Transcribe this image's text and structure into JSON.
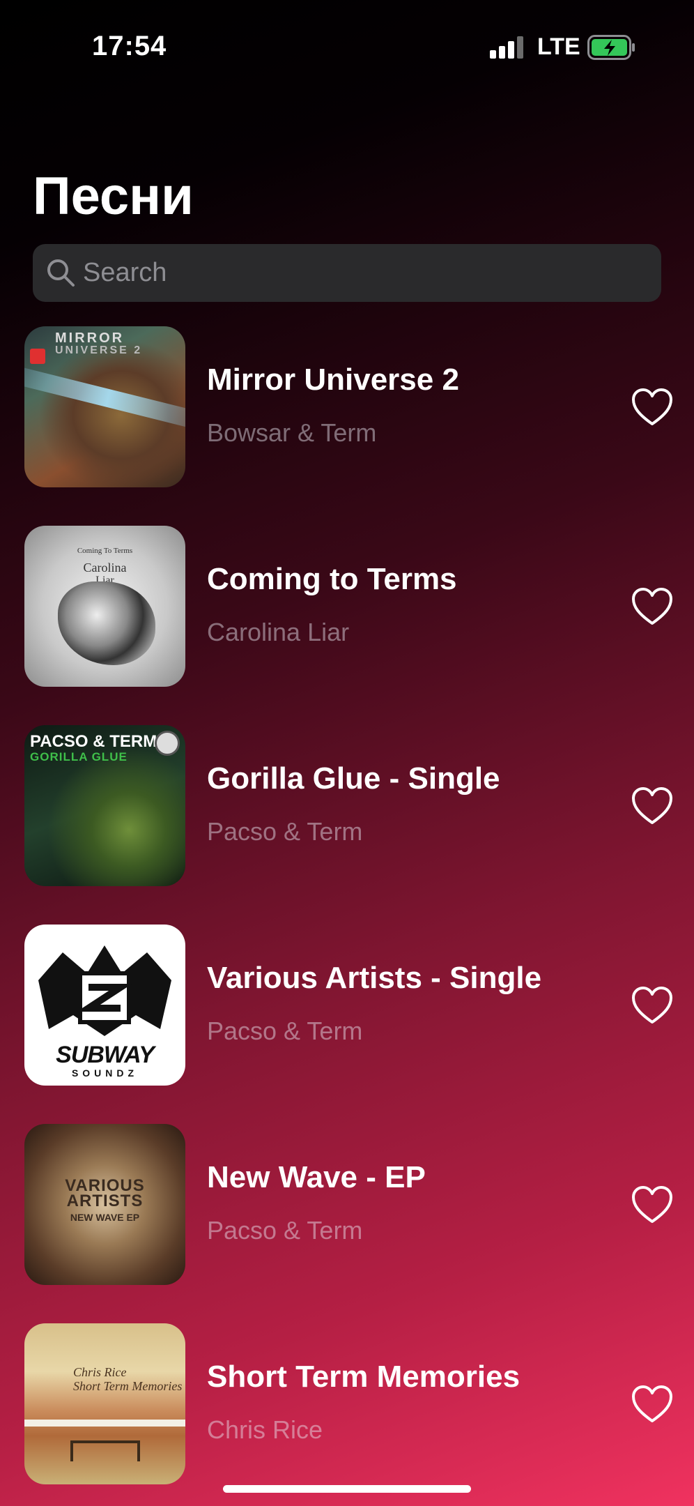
{
  "status_bar": {
    "time": "17:54",
    "network": "LTE"
  },
  "header": {
    "title": "Песни"
  },
  "search": {
    "placeholder": "Search"
  },
  "songs": [
    {
      "title": "Mirror Universe 2",
      "artist": "Bowsar & Term",
      "cover_text": [
        "MIRROR",
        "UNIVERSE 2"
      ]
    },
    {
      "title": "Coming to Terms",
      "artist": "Carolina Liar",
      "cover_text": [
        "Coming To Terms",
        "Carolina",
        "Liar"
      ]
    },
    {
      "title": "Gorilla Glue - Single",
      "artist": "Pacso & Term",
      "cover_text": [
        "PACSO & TERM",
        "GORILLA GLUE"
      ]
    },
    {
      "title": "Various Artists - Single",
      "artist": "Pacso & Term",
      "cover_text": [
        "SUBWAY",
        "SOUNDZ"
      ]
    },
    {
      "title": "New Wave - EP",
      "artist": "Pacso & Term",
      "cover_text": [
        "VARIOUS",
        "ARTISTS",
        "NEW WAVE EP"
      ]
    },
    {
      "title": "Short Term Memories",
      "artist": "Chris Rice",
      "cover_text": [
        "Chris Rice",
        "Short Term Memories"
      ]
    }
  ],
  "colors": {
    "accent": "#f0325f",
    "battery_charging": "#34c759"
  }
}
